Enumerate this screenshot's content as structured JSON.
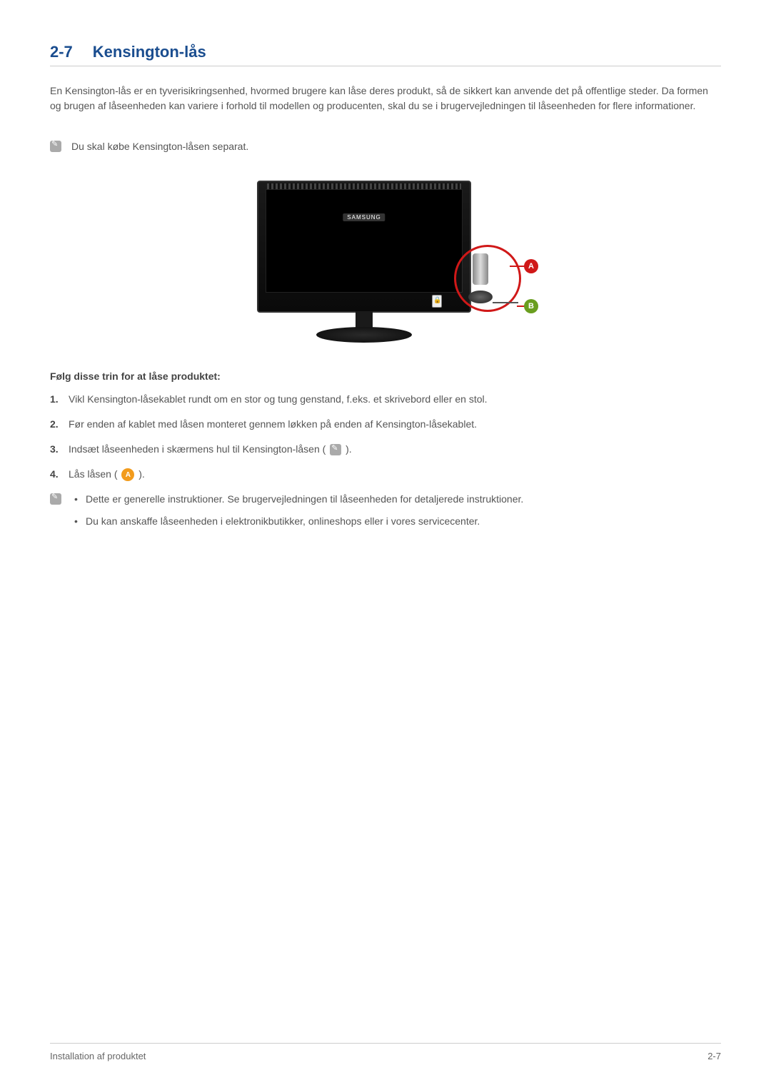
{
  "section": {
    "number": "2-7",
    "title": "Kensington-lås"
  },
  "intro": "En Kensington-lås er en tyverisikringsenhed, hvormed brugere kan låse deres produkt, så de sikkert kan anvende det på offentlige steder. Da formen og brugen af låseenheden kan variere i forhold til modellen og producenten, skal du se i brugervejledningen til låseenheden for flere informationer.",
  "note": "Du skal købe Kensington-låsen separat.",
  "figure": {
    "brand": "SAMSUNG",
    "marker_a": "A",
    "marker_b": "B"
  },
  "steps_title": "Følg disse trin for at låse produktet:",
  "steps": [
    "Vikl Kensington-låsekablet rundt om en stor og tung genstand, f.eks. et skrivebord eller en stol.",
    "Før enden af kablet med låsen monteret gennem løkken på enden af Kensington-låsekablet."
  ],
  "step3_prefix": "Indsæt låseenheden i skærmens hul til Kensington-låsen ( ",
  "step3_suffix": "  ).",
  "step4_prefix": "Lås låsen (",
  "step4_marker": "A",
  "step4_suffix": ").",
  "bottom_notes": [
    "Dette er generelle instruktioner. Se brugervejledningen til låseenheden for detaljerede instruktioner.",
    "Du kan anskaffe låseenheden i elektronikbutikker, onlineshops eller i vores servicecenter."
  ],
  "footer": {
    "left": "Installation af produktet",
    "right": "2-7"
  }
}
